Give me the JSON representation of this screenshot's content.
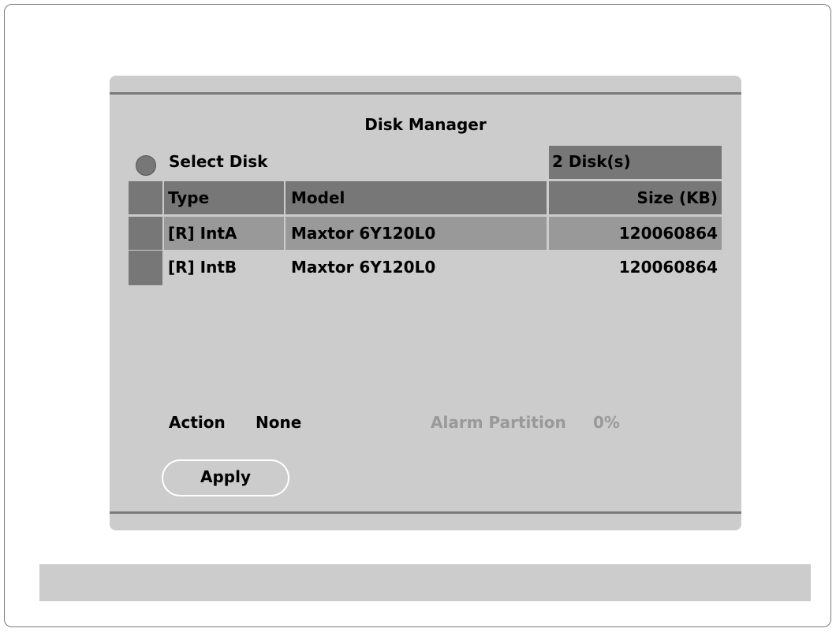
{
  "panel": {
    "title": "Disk Manager",
    "select_disk_label": "Select Disk",
    "disk_count": "2 Disk(s)"
  },
  "table": {
    "headers": {
      "type": "Type",
      "model": "Model",
      "size": "Size (KB)"
    },
    "rows": [
      {
        "type": "[R] IntA",
        "model": "Maxtor 6Y120L0",
        "size": "120060864",
        "selected": true
      },
      {
        "type": "[R] IntB",
        "model": "Maxtor 6Y120L0",
        "size": "120060864",
        "selected": false
      }
    ]
  },
  "action": {
    "label": "Action",
    "value": "None"
  },
  "alarm": {
    "label": "Alarm Partition",
    "value": "0%"
  },
  "apply_label": "Apply",
  "colors": {
    "panel_bg": "#cccccc",
    "header_bg": "#777777",
    "selected_row_bg": "#999999",
    "disabled_text": "#999999"
  },
  "icons": {
    "select_disk": "radio-circle-icon"
  }
}
